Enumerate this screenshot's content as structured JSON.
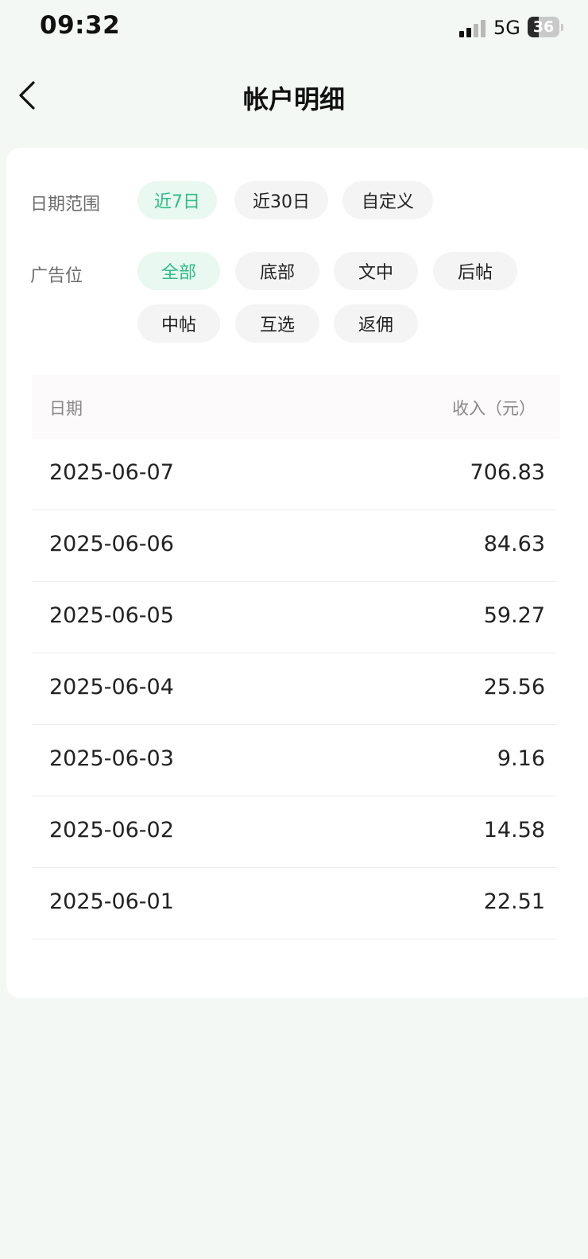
{
  "status_bar": {
    "time": "09:32",
    "network": "5G",
    "battery": "36",
    "battery_level": 0.36,
    "signal_bars_active": 2,
    "signal_bars_total": 4
  },
  "nav": {
    "back_icon": "chevron-left-icon",
    "title": "帐户明细"
  },
  "filters": {
    "date_range": {
      "label": "日期范围",
      "options": [
        "近7日",
        "近30日",
        "自定义"
      ],
      "selected": "近7日"
    },
    "ad_slot": {
      "label": "广告位",
      "options": [
        "全部",
        "底部",
        "文中",
        "后帖",
        "中帖",
        "互选",
        "返佣"
      ],
      "selected": "全部"
    }
  },
  "table": {
    "headers": {
      "date": "日期",
      "income": "收入（元）"
    },
    "rows": [
      {
        "date": "2025-06-07",
        "amount": "706.83"
      },
      {
        "date": "2025-06-06",
        "amount": "84.63"
      },
      {
        "date": "2025-06-05",
        "amount": "59.27"
      },
      {
        "date": "2025-06-04",
        "amount": "25.56"
      },
      {
        "date": "2025-06-03",
        "amount": "9.16"
      },
      {
        "date": "2025-06-02",
        "amount": "14.58"
      },
      {
        "date": "2025-06-01",
        "amount": "22.51"
      }
    ]
  },
  "colors": {
    "accent": "#2ebd85",
    "accent_bg": "#e9f8f1",
    "page_bg": "#f3f8f5"
  }
}
